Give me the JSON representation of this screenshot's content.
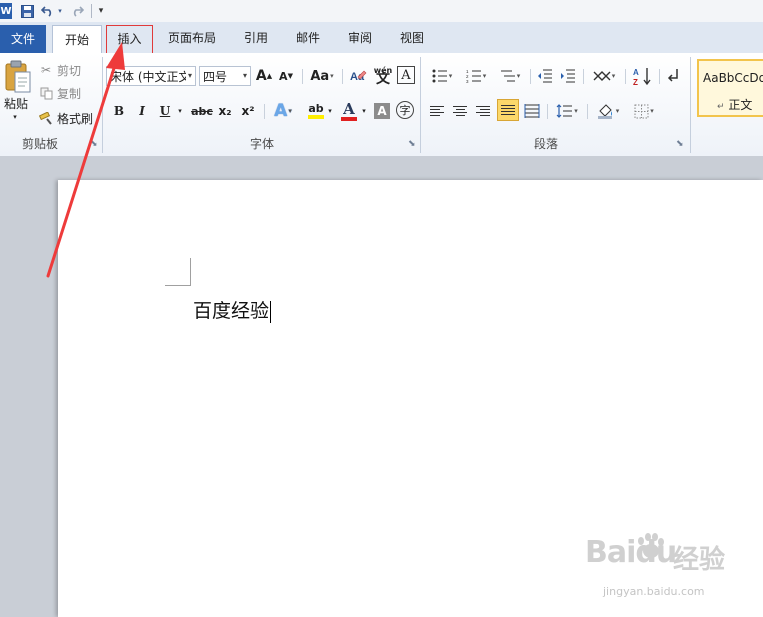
{
  "tabs": {
    "file": "文件",
    "home": "开始",
    "insert": "插入",
    "page_layout": "页面布局",
    "references": "引用",
    "mailings": "邮件",
    "review": "审阅",
    "view": "视图"
  },
  "clipboard": {
    "paste": "粘贴",
    "cut": "剪切",
    "copy": "复制",
    "format_painter": "格式刷",
    "group_label": "剪贴板"
  },
  "font": {
    "font_name": "宋体 (中文正文",
    "font_size": "四号",
    "group_label": "字体",
    "bold": "B",
    "italic": "I",
    "underline": "U",
    "strike": "abc",
    "subscript": "x₂",
    "superscript": "x²",
    "change_case": "Aa",
    "grow": "A",
    "shrink": "A",
    "clear": "A",
    "phonetic": "wén",
    "phonetic_char": "文",
    "border_char": "A",
    "text_effect": "A",
    "highlight": "ab",
    "font_color": "A",
    "shading": "A",
    "enclose": "字"
  },
  "paragraph": {
    "group_label": "段落",
    "sort": "A↓Z",
    "pilcrow": "↵"
  },
  "styles": {
    "preview": "AaBbCcDd",
    "name": "正文"
  },
  "document": {
    "text": "百度经验"
  },
  "watermark": {
    "brand": "Baidu",
    "brand_cn": "经验",
    "url": "jingyan.baidu.com"
  },
  "colors": {
    "file_tab": "#2a5fad",
    "highlight_box": "#e03a3a",
    "arrow": "#ee3b3b",
    "font_color_bar": "#e02020",
    "highlight_bar": "#ffee00"
  }
}
